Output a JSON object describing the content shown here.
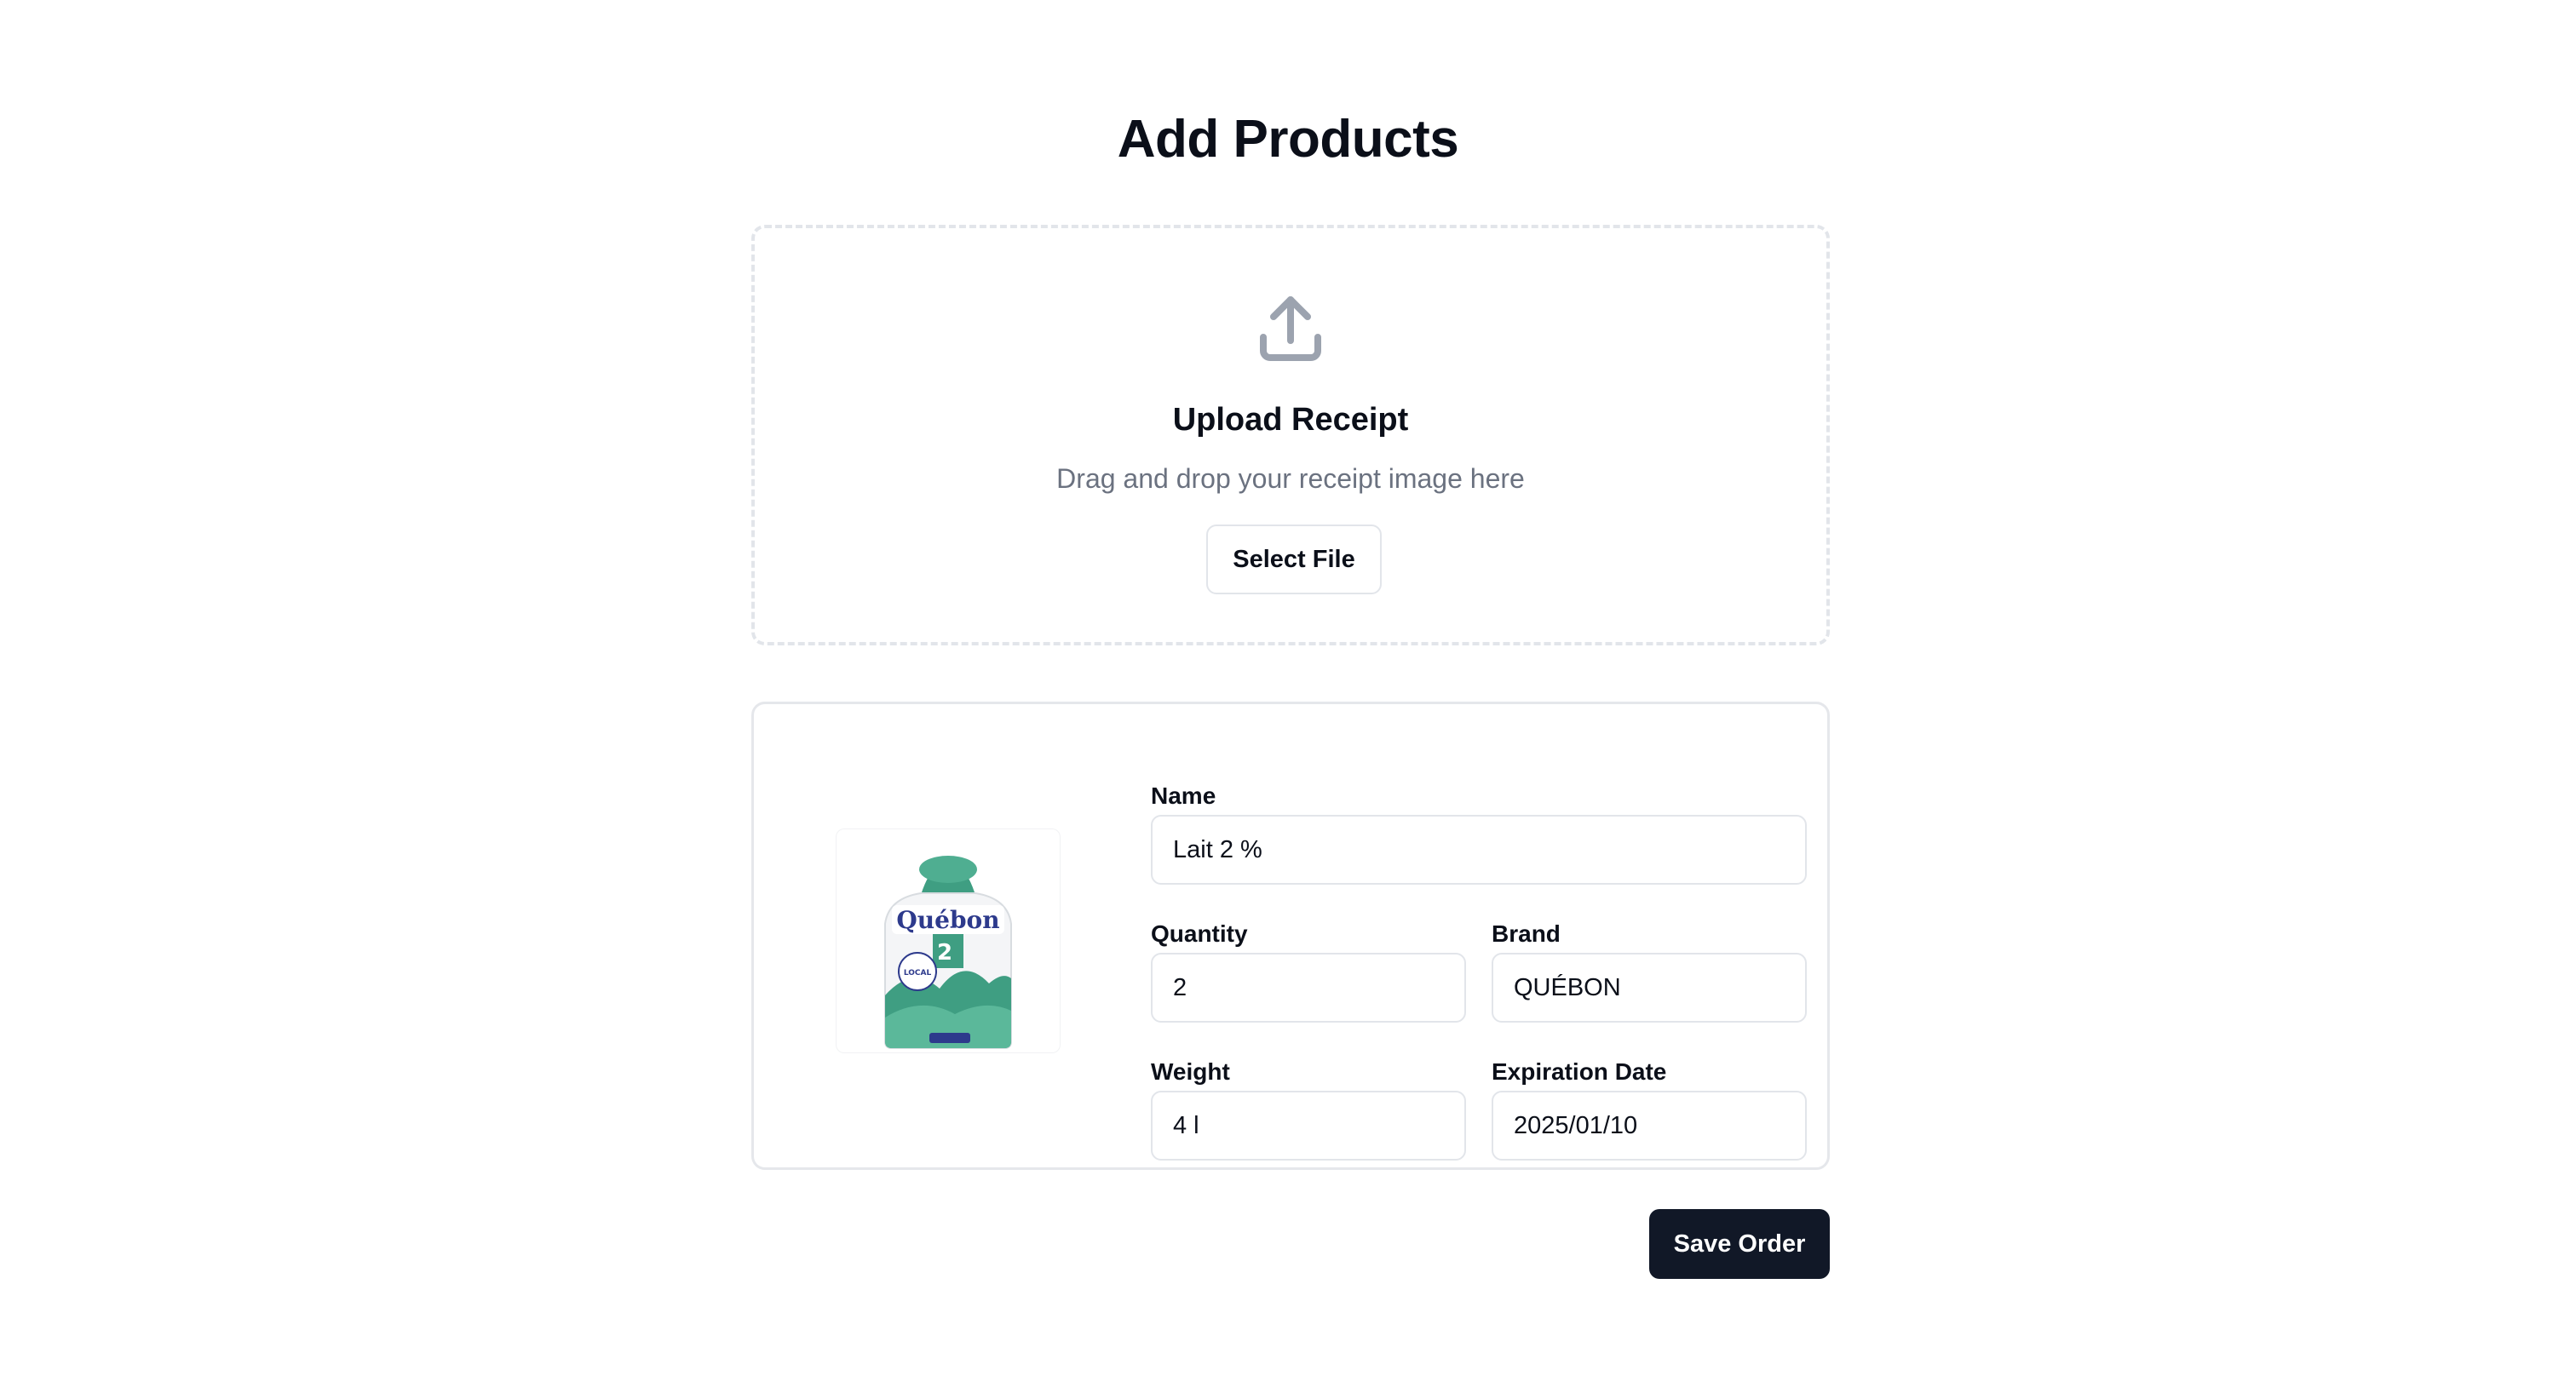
{
  "page": {
    "title": "Add Products"
  },
  "upload": {
    "icon": "upload-icon",
    "title": "Upload Receipt",
    "subtitle": "Drag and drop your receipt image here",
    "select_file_label": "Select File"
  },
  "product": {
    "image": {
      "icon": "milk-bag-image",
      "brand_text": "Québon",
      "fat_text": "2",
      "local_text": "LOCAL"
    },
    "fields": {
      "name": {
        "label": "Name",
        "value": "Lait 2 %"
      },
      "quantity": {
        "label": "Quantity",
        "value": "2"
      },
      "brand": {
        "label": "Brand",
        "value": "QUÉBON"
      },
      "weight": {
        "label": "Weight",
        "value": "4 l"
      },
      "expiration": {
        "label": "Expiration Date",
        "value": "2025/01/10"
      }
    }
  },
  "actions": {
    "save_label": "Save Order"
  },
  "colors": {
    "primary_button": "#111827",
    "border": "#e2e5ea",
    "muted_text": "#6b7280",
    "icon_gray": "#9ca3af",
    "product_green": "#3f9e82"
  }
}
